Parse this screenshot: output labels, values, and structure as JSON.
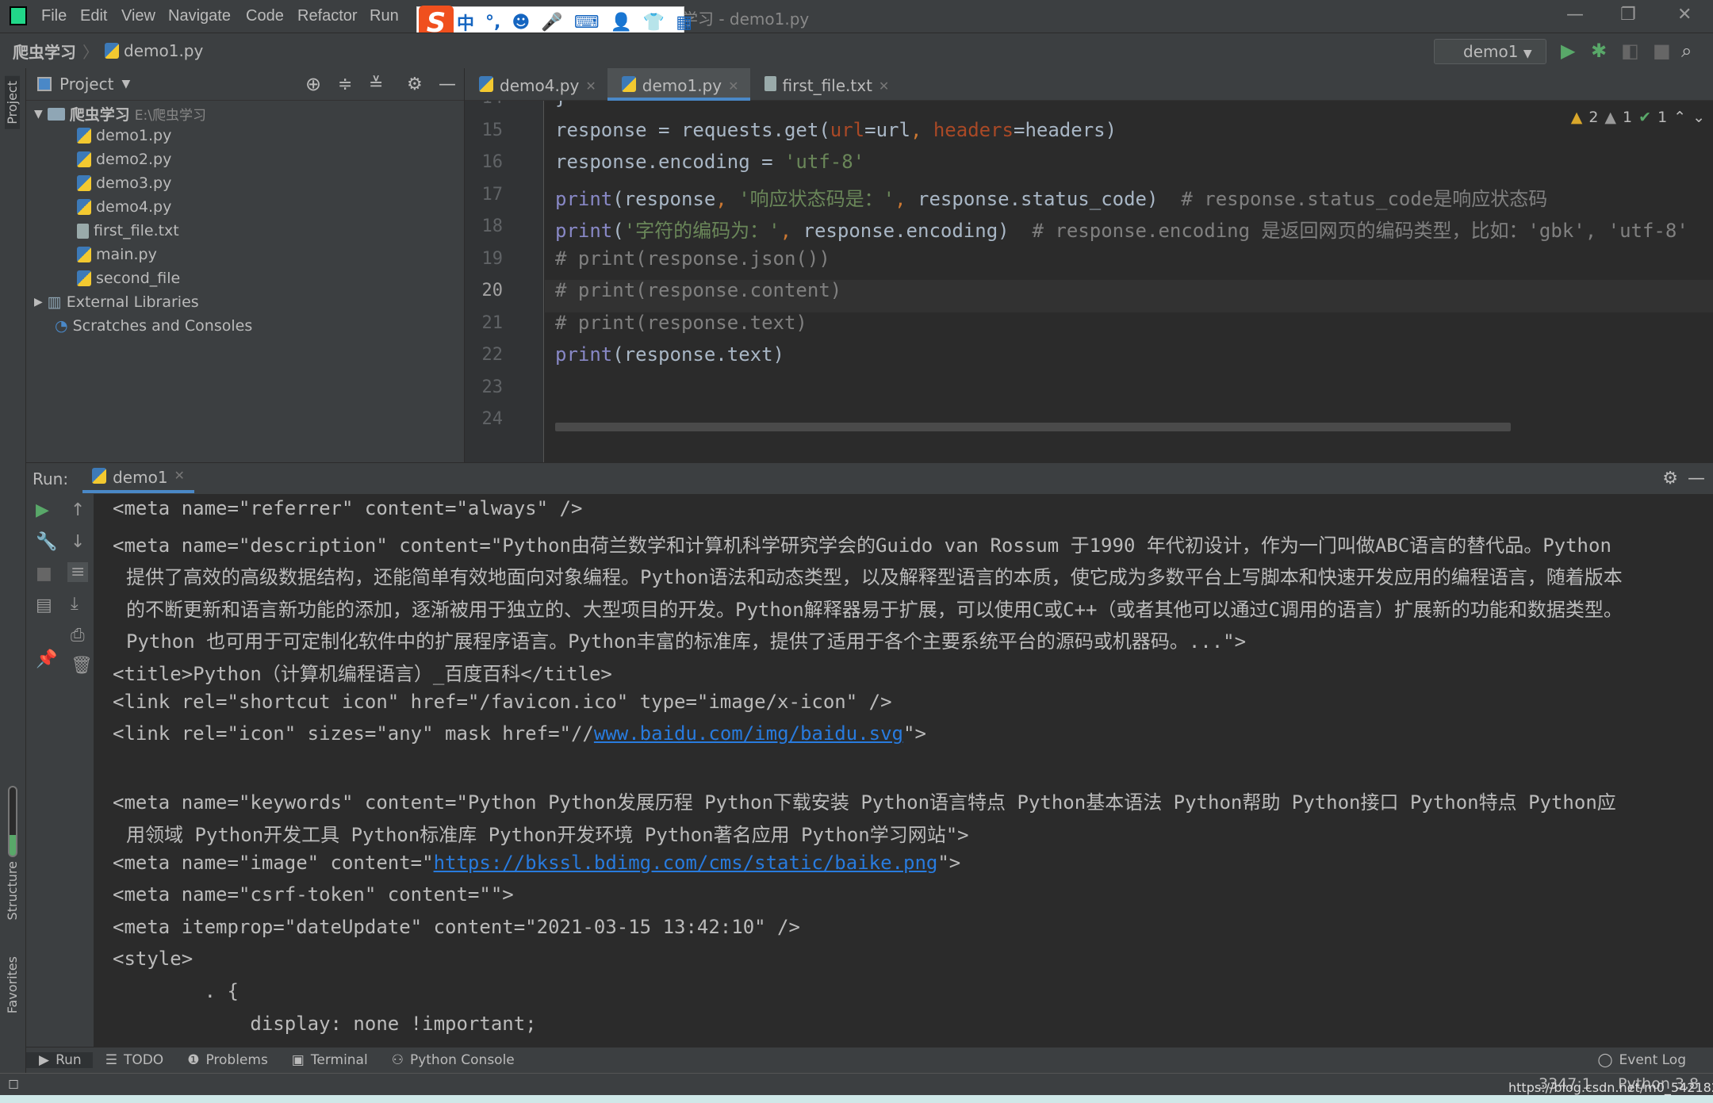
{
  "window": {
    "title": "爬虫学习 - demo1.py",
    "menu": [
      "File",
      "Edit",
      "View",
      "Navigate",
      "Code",
      "Refactor",
      "Run"
    ]
  },
  "ime": {
    "logo": "S",
    "items": [
      "中",
      "°,",
      "☻",
      "🎤",
      "⌨",
      "👤",
      "👕",
      "▦"
    ]
  },
  "breadcrumb": [
    "爬虫学习",
    "demo1.py"
  ],
  "run_config": "demo1",
  "side_labels": {
    "project": "Project",
    "structure": "Structure",
    "favorites": "Favorites"
  },
  "project": {
    "header": "Project",
    "root": {
      "name": "爬虫学习",
      "path": "E:\\爬虫学习"
    },
    "files": [
      {
        "name": "demo1.py",
        "type": "py"
      },
      {
        "name": "demo2.py",
        "type": "py"
      },
      {
        "name": "demo3.py",
        "type": "py"
      },
      {
        "name": "demo4.py",
        "type": "py"
      },
      {
        "name": "first_file.txt",
        "type": "txt"
      },
      {
        "name": "main.py",
        "type": "py"
      },
      {
        "name": "second_file",
        "type": "py"
      }
    ],
    "external": "External Libraries",
    "scratches": "Scratches and Consoles"
  },
  "tabs": [
    {
      "label": "demo4.py",
      "active": false
    },
    {
      "label": "demo1.py",
      "active": true
    },
    {
      "label": "first_file.txt",
      "active": false
    }
  ],
  "inspections": {
    "warnings": "2",
    "weak_warnings": "1",
    "ok": "1"
  },
  "editor": {
    "current_line": 20,
    "lines": [
      {
        "n": "14",
        "html": "<span>}</span>"
      },
      {
        "n": "15",
        "html": "response = requests.get(<span class='param'>url</span>=url<span class='pun'>, </span><span class='param'>headers</span>=headers)"
      },
      {
        "n": "16",
        "html": "response.encoding = <span class='str'>'utf-8'</span>"
      },
      {
        "n": "17",
        "html": "<span class='kw'>print</span>(response<span class='pun'>, </span><span class='str'>'响应状态码是：'</span><span class='pun'>, </span>response.status_code)  <span class='cm'># response.status_code是响应状态码</span>"
      },
      {
        "n": "18",
        "html": "<span class='kw'>print</span>(<span class='str'>'字符的编码为：'</span><span class='pun'>, </span>response.encoding)  <span class='cm'># response.encoding 是返回网页的编码类型，比如：'gbk', 'utf-8'</span>"
      },
      {
        "n": "19",
        "html": "<span class='cm'># print(response.json())</span>"
      },
      {
        "n": "20",
        "html": "<span class='cm'># print(response.content)</span>"
      },
      {
        "n": "21",
        "html": "<span class='cm'># print(response.text)</span>"
      },
      {
        "n": "22",
        "html": "<span class='kw'>print</span>(response.text)"
      },
      {
        "n": "23",
        "html": ""
      },
      {
        "n": "24",
        "html": ""
      }
    ]
  },
  "run": {
    "label": "Run:",
    "tab": "demo1",
    "lines": [
      {
        "t": "<meta name=\"referrer\" content=\"always\" />"
      },
      {
        "t": "<meta name=\"description\" content=\"Python由荷兰数学和计算机科学研究学会的Guido van Rossum 于1990 年代初设计，作为一门叫做ABC语言的替代品。Python"
      },
      {
        "t": "提供了高效的高级数据结构，还能简单有效地面向对象编程。Python语法和动态类型，以及解释型语言的本质，使它成为多数平台上写脚本和快速开发应用的编程语言，随着版本",
        "ind": true
      },
      {
        "t": "的不断更新和语言新功能的添加，逐渐被用于独立的、大型项目的开发。Python解释器易于扩展，可以使用C或C++（或者其他可以通过C调用的语言）扩展新的功能和数据类型。",
        "ind": true
      },
      {
        "t": "Python 也可用于可定制化软件中的扩展程序语言。Python丰富的标准库，提供了适用于各个主要系统平台的源码或机器码。...\">",
        "ind": true
      },
      {
        "t": "<title>Python（计算机编程语言）_百度百科</title>"
      },
      {
        "t": "<link rel=\"shortcut icon\" href=\"/favicon.ico\" type=\"image/x-icon\" />"
      },
      {
        "t": "<link rel=\"icon\" sizes=\"any\" mask href=\"//",
        "link": "www.baidu.com/img/baidu.svg",
        "after": "\">"
      },
      {
        "t": ""
      },
      {
        "t": "<meta name=\"keywords\" content=\"Python Python发展历程 Python下载安装 Python语言特点 Python基本语法 Python帮助 Python接口 Python特点 Python应"
      },
      {
        "t": "用领域 Python开发工具 Python标准库 Python开发环境 Python著名应用 Python学习网站\">",
        "ind": true
      },
      {
        "t": "<meta name=\"image\" content=\"",
        "link": "https://bkssl.bdimg.com/cms/static/baike.png",
        "after": "\">"
      },
      {
        "t": "<meta name=\"csrf-token\" content=\"\">"
      },
      {
        "t": "<meta itemprop=\"dateUpdate\" content=\"2021-03-15 13:42:10\" />"
      },
      {
        "t": "<style>"
      },
      {
        "t": "        . {"
      },
      {
        "t": "            display: none !important;"
      }
    ]
  },
  "toolwindows": [
    "Run",
    "TODO",
    "Problems",
    "Terminal",
    "Python Console"
  ],
  "event_log": "Event Log",
  "status": {
    "position": "3347:1",
    "interpreter": "Python 3.8",
    "watermark": "https://blog.csdn.net/m0_54218263"
  }
}
